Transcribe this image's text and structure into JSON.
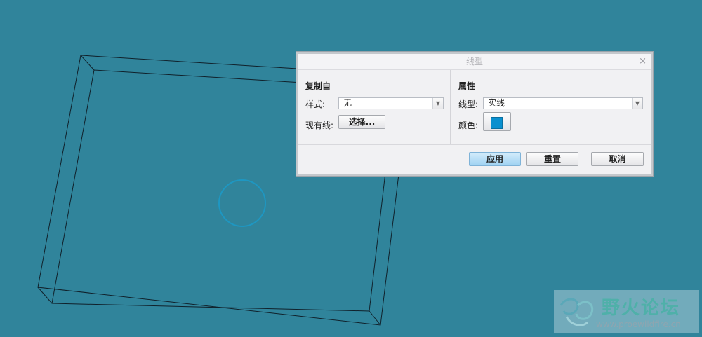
{
  "dialog": {
    "title": "线型",
    "close_glyph": "×",
    "copy_from": {
      "title": "复制自",
      "style_label": "样式:",
      "style_value": "无",
      "existing_line_label": "现有线:",
      "select_button": "选择..."
    },
    "properties": {
      "title": "属性",
      "line_type_label": "线型:",
      "line_type_value": "实线",
      "color_label": "颜色:",
      "color_value": "#0a90cf"
    },
    "buttons": {
      "apply": "应用",
      "reset": "重置",
      "cancel": "取消"
    }
  },
  "watermark": {
    "title": "野火论坛",
    "url": "www.proewildfire.cn"
  },
  "colors": {
    "background": "#30849b",
    "accent": "#0a90cf"
  },
  "icons": [
    "dropdown-arrow-icon",
    "close-icon",
    "forum-logo-icon"
  ]
}
